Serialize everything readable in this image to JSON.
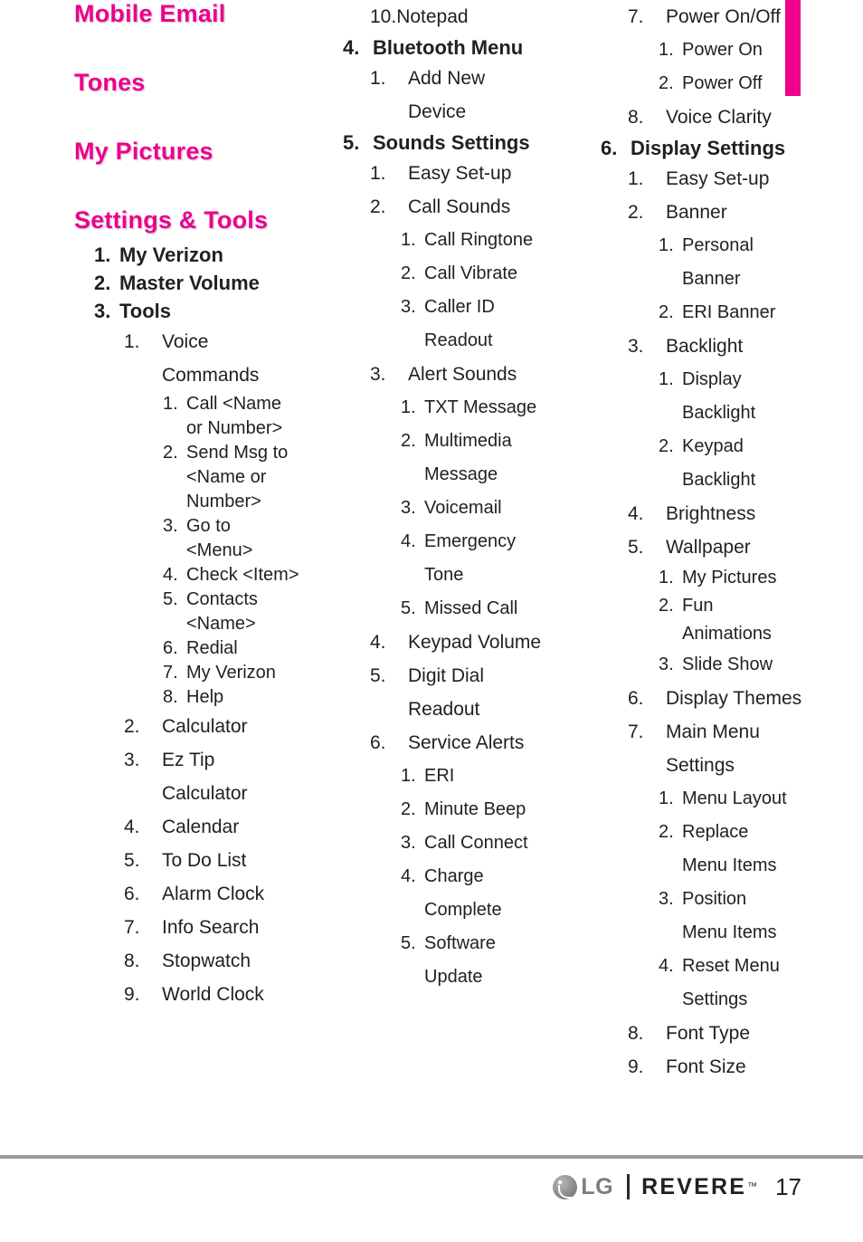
{
  "page": {
    "number": "17",
    "corner_tab_color": "#ec008c",
    "heading_color": "#ec008c"
  },
  "footer": {
    "brand": "LG",
    "model": "REVERE",
    "trademark": "™",
    "page_number": "17"
  },
  "columns": [
    {
      "id": "column-1",
      "blocks": [
        {
          "type": "heading",
          "text": "Mobile Email"
        },
        {
          "type": "heading",
          "text": "Tones"
        },
        {
          "type": "heading",
          "text": "My Pictures"
        },
        {
          "type": "heading",
          "text": "Settings & Tools"
        },
        {
          "type": "lvl1",
          "num": "1.",
          "text": "My Verizon"
        },
        {
          "type": "lvl1",
          "num": "2.",
          "text": "Master Volume"
        },
        {
          "type": "lvl1",
          "num": "3.",
          "text": "Tools"
        },
        {
          "type": "lvl2",
          "num": "1.",
          "text": "Voice",
          "cont": "Commands"
        },
        {
          "type": "lvl3",
          "num": "1.",
          "text": "Call <Name",
          "cont": "or Number>"
        },
        {
          "type": "lvl3",
          "num": "2.",
          "text": "Send Msg to",
          "cont": "<Name or",
          "cont2": "Number>"
        },
        {
          "type": "lvl3",
          "num": "3.",
          "text": "Go to",
          "cont": "<Menu>"
        },
        {
          "type": "lvl3",
          "num": "4.",
          "text": "Check <Item>"
        },
        {
          "type": "lvl3",
          "num": "5.",
          "text": "Contacts",
          "cont": "<Name>"
        },
        {
          "type": "lvl3",
          "num": "6.",
          "text": "Redial"
        },
        {
          "type": "lvl3",
          "num": "7.",
          "text": "My Verizon"
        },
        {
          "type": "lvl3",
          "num": "8.",
          "text": "Help"
        },
        {
          "type": "lvl2",
          "num": "2.",
          "text": "Calculator"
        },
        {
          "type": "lvl2",
          "num": "3.",
          "text": "Ez Tip",
          "cont": "Calculator"
        },
        {
          "type": "lvl2",
          "num": "4.",
          "text": "Calendar"
        },
        {
          "type": "lvl2",
          "num": "5.",
          "text": "To Do List"
        },
        {
          "type": "lvl2",
          "num": "6.",
          "text": "Alarm Clock"
        },
        {
          "type": "lvl2",
          "num": "7.",
          "text": "Info Search"
        },
        {
          "type": "lvl2",
          "num": "8.",
          "text": "Stopwatch"
        },
        {
          "type": "lvl2",
          "num": "9.",
          "text": "World Clock"
        }
      ]
    },
    {
      "id": "column-2",
      "blocks": [
        {
          "type": "lvl2",
          "num": "10.",
          "text": "Notepad",
          "nospace": true
        },
        {
          "type": "lvl1",
          "num": "4.",
          "text": "Bluetooth Menu"
        },
        {
          "type": "lvl2",
          "num": "1.",
          "text": "Add New",
          "cont": "Device"
        },
        {
          "type": "lvl1",
          "num": "5.",
          "text": "Sounds Settings"
        },
        {
          "type": "lvl2",
          "num": "1.",
          "text": "Easy Set-up"
        },
        {
          "type": "lvl2",
          "num": "2.",
          "text": "Call Sounds"
        },
        {
          "type": "lvl3",
          "num": "1.",
          "text": "Call Ringtone"
        },
        {
          "type": "lvl3",
          "num": "2.",
          "text": "Call Vibrate"
        },
        {
          "type": "lvl3",
          "num": "3.",
          "text": "Caller ID",
          "cont": "Readout"
        },
        {
          "type": "lvl2",
          "num": "3.",
          "text": "Alert Sounds"
        },
        {
          "type": "lvl3",
          "num": "1.",
          "text": "TXT Message"
        },
        {
          "type": "lvl3",
          "num": "2.",
          "text": "Multimedia",
          "cont": "Message"
        },
        {
          "type": "lvl3",
          "num": "3.",
          "text": "Voicemail"
        },
        {
          "type": "lvl3",
          "num": "4.",
          "text": "Emergency",
          "cont": "Tone"
        },
        {
          "type": "lvl3",
          "num": "5.",
          "text": "Missed Call"
        },
        {
          "type": "lvl2",
          "num": "4.",
          "text": "Keypad Volume"
        },
        {
          "type": "lvl2",
          "num": "5.",
          "text": "Digit Dial",
          "cont": "Readout"
        },
        {
          "type": "lvl2",
          "num": "6.",
          "text": "Service Alerts"
        },
        {
          "type": "lvl3",
          "num": "1.",
          "text": "ERI"
        },
        {
          "type": "lvl3",
          "num": "2.",
          "text": "Minute Beep"
        },
        {
          "type": "lvl3",
          "num": "3.",
          "text": "Call Connect"
        },
        {
          "type": "lvl3",
          "num": "4.",
          "text": "Charge",
          "cont": "Complete"
        },
        {
          "type": "lvl3",
          "num": "5.",
          "text": "Software",
          "cont": "Update"
        }
      ]
    },
    {
      "id": "column-3",
      "blocks": [
        {
          "type": "lvl2",
          "num": "7.",
          "text": "Power On/Off"
        },
        {
          "type": "lvl3",
          "num": "1.",
          "text": "Power On"
        },
        {
          "type": "lvl3",
          "num": "2.",
          "text": "Power Off"
        },
        {
          "type": "lvl2",
          "num": "8.",
          "text": "Voice Clarity"
        },
        {
          "type": "lvl1",
          "num": "6.",
          "text": "Display Settings"
        },
        {
          "type": "lvl2",
          "num": "1.",
          "text": "Easy Set-up"
        },
        {
          "type": "lvl2",
          "num": "2.",
          "text": "Banner"
        },
        {
          "type": "lvl3",
          "num": "1.",
          "text": "Personal",
          "cont": "Banner"
        },
        {
          "type": "lvl3",
          "num": "2.",
          "text": "ERI Banner"
        },
        {
          "type": "lvl2",
          "num": "3.",
          "text": "Backlight"
        },
        {
          "type": "lvl3",
          "num": "1.",
          "text": "Display",
          "cont": "Backlight"
        },
        {
          "type": "lvl3",
          "num": "2.",
          "text": "Keypad",
          "cont": "Backlight"
        },
        {
          "type": "lvl2",
          "num": "4.",
          "text": "Brightness"
        },
        {
          "type": "lvl2",
          "num": "5.",
          "text": "Wallpaper"
        },
        {
          "type": "lvl3",
          "num": "1.",
          "text": "My Pictures",
          "pair": true
        },
        {
          "type": "lvl3",
          "num": "2.",
          "text": "Fun",
          "cont": "Animations",
          "pair": true
        },
        {
          "type": "lvl3",
          "num": "3.",
          "text": "Slide Show"
        },
        {
          "type": "lvl2",
          "num": "6.",
          "text": "Display Themes"
        },
        {
          "type": "lvl2",
          "num": "7.",
          "text": "Main Menu",
          "cont": "Settings"
        },
        {
          "type": "lvl3",
          "num": "1.",
          "text": "Menu Layout"
        },
        {
          "type": "lvl3",
          "num": "2.",
          "text": "Replace",
          "cont": "Menu Items"
        },
        {
          "type": "lvl3",
          "num": "3.",
          "text": "Position",
          "cont": "Menu Items"
        },
        {
          "type": "lvl3",
          "num": "4.",
          "text": "Reset Menu",
          "cont": "Settings"
        },
        {
          "type": "lvl2",
          "num": "8.",
          "text": "Font Type"
        },
        {
          "type": "lvl2",
          "num": "9.",
          "text": "Font Size"
        }
      ]
    }
  ]
}
